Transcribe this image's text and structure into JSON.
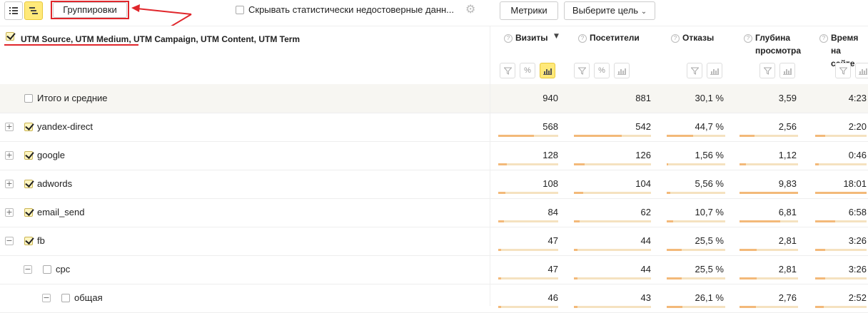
{
  "toolbar": {
    "groupings_label": "Группировки",
    "hide_stats_label": "Скрывать статистически недостоверные данн...",
    "metrics_label": "Метрики",
    "goal_label": "Выберите цель"
  },
  "grouping_header": {
    "part1": "UTM Source, UTM Medium,",
    "part2": " UTM Campaign, UTM Content, UTM Term"
  },
  "columns": [
    {
      "title1": "Визиты",
      "title2": "",
      "sort": "▼"
    },
    {
      "title1": "Посетители",
      "title2": "",
      "sort": ""
    },
    {
      "title1": "Отказы",
      "title2": "",
      "sort": ""
    },
    {
      "title1": "Глубина",
      "title2": "просмотра",
      "sort": ""
    },
    {
      "title1": "Время",
      "title2": "на сайте",
      "sort": ""
    }
  ],
  "rows": [
    {
      "label": "Итого и средние",
      "level": 0,
      "total": true,
      "checked": false,
      "tree": "",
      "values": [
        "940",
        "881",
        "30,1 %",
        "3,59",
        "4:23"
      ],
      "bars": [
        0,
        0,
        0,
        0,
        0
      ]
    },
    {
      "label": "yandex-direct",
      "level": 0,
      "total": false,
      "checked": true,
      "tree": "+",
      "values": [
        "568",
        "542",
        "44,7 %",
        "2,56",
        "2:20"
      ],
      "bars": [
        0.6,
        0.62,
        0.45,
        0.26,
        0.2
      ]
    },
    {
      "label": "google",
      "level": 0,
      "total": false,
      "checked": true,
      "tree": "+",
      "values": [
        "128",
        "126",
        "1,56 %",
        "1,12",
        "0:46"
      ],
      "bars": [
        0.14,
        0.14,
        0.02,
        0.11,
        0.07
      ]
    },
    {
      "label": "adwords",
      "level": 0,
      "total": false,
      "checked": true,
      "tree": "+",
      "values": [
        "108",
        "104",
        "5,56 %",
        "9,83",
        "18:01"
      ],
      "bars": [
        0.12,
        0.12,
        0.06,
        1.0,
        1.0
      ]
    },
    {
      "label": "email_send",
      "level": 0,
      "total": false,
      "checked": true,
      "tree": "+",
      "values": [
        "84",
        "62",
        "10,7 %",
        "6,81",
        "6:58"
      ],
      "bars": [
        0.09,
        0.07,
        0.11,
        0.69,
        0.39
      ]
    },
    {
      "label": "fb",
      "level": 0,
      "total": false,
      "checked": true,
      "tree": "−",
      "values": [
        "47",
        "44",
        "25,5 %",
        "2,81",
        "3:26"
      ],
      "bars": [
        0.05,
        0.05,
        0.26,
        0.29,
        0.19
      ]
    },
    {
      "label": "cpc",
      "level": 1,
      "total": false,
      "checked": false,
      "tree": "−",
      "values": [
        "47",
        "44",
        "25,5 %",
        "2,81",
        "3:26"
      ],
      "bars": [
        0.05,
        0.05,
        0.26,
        0.29,
        0.19
      ]
    },
    {
      "label": "общая",
      "level": 2,
      "total": false,
      "checked": false,
      "tree": "−",
      "values": [
        "46",
        "43",
        "26,1 %",
        "2,76",
        "2:52"
      ],
      "bars": [
        0.05,
        0.05,
        0.27,
        0.28,
        0.16
      ]
    }
  ],
  "colors": {
    "accent": "#ffe97a",
    "bar": "#f3b979",
    "annotation": "#e0262b"
  }
}
